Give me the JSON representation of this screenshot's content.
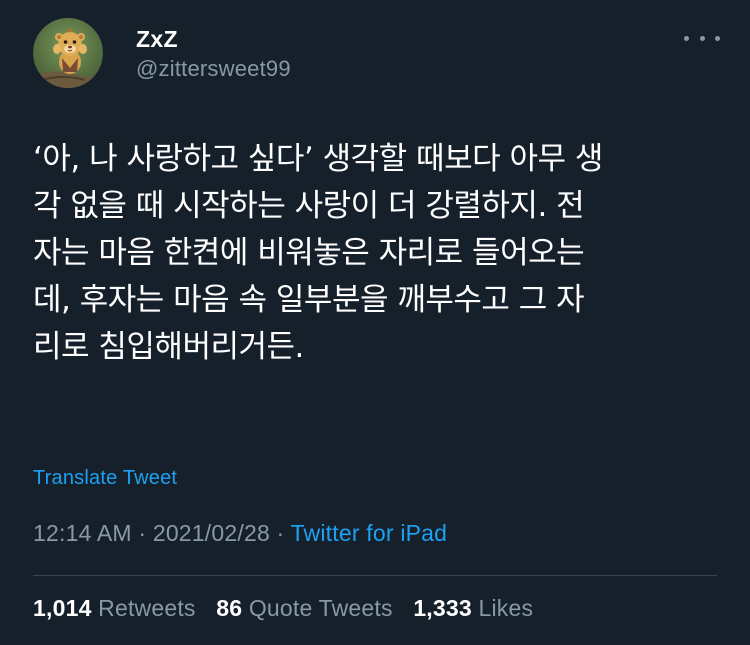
{
  "author": {
    "display_name": "ZxZ",
    "handle": "@zittersweet99",
    "avatar_icon": "cartoon-lion-cub-avatar"
  },
  "tweet": {
    "text": "‘아, 나 사랑하고 싶다’ 생각할 때보다 아무 생\n각 없을 때 시작하는 사랑이 더 강렬하지. 전\n자는 마음 한켠에 비워놓은 자리로 들어오는\n데, 후자는 마음 속 일부분을 깨부수고 그 자\n리로 침입해버리거든.",
    "translate_label": "Translate Tweet"
  },
  "meta": {
    "time": "12:14 AM",
    "separator": " · ",
    "date": "2021/02/28",
    "source": "Twitter for iPad"
  },
  "stats": {
    "retweets_count": "1,014",
    "retweets_label": "Retweets",
    "quote_tweets_count": "86",
    "quote_tweets_label": "Quote Tweets",
    "likes_count": "1,333",
    "likes_label": "Likes"
  },
  "colors": {
    "background": "#15202b",
    "text": "#ffffff",
    "secondary_text": "#8899a6",
    "link": "#1da1f2",
    "divider": "#38444d"
  }
}
